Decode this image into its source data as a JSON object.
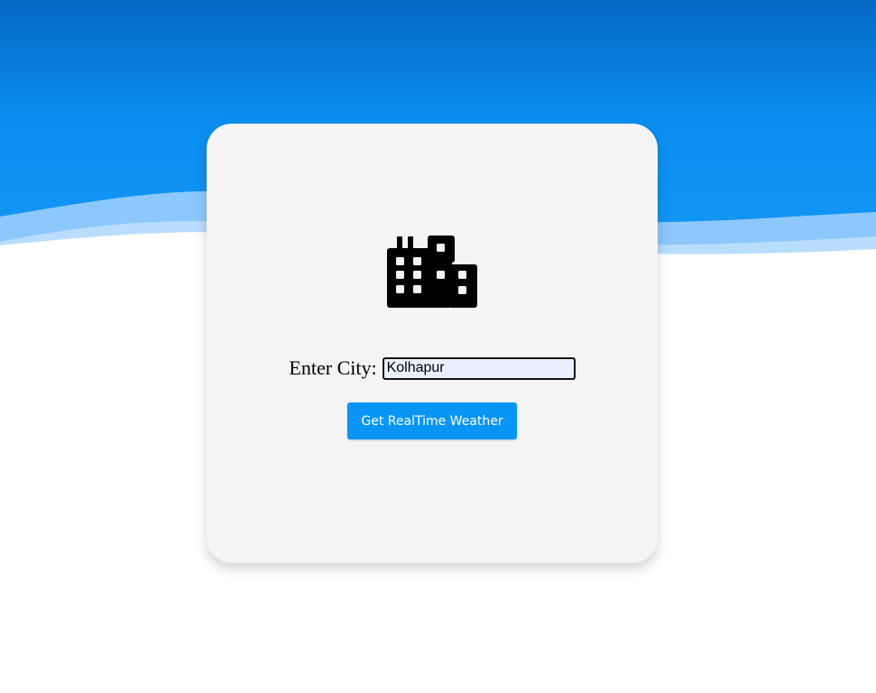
{
  "colors": {
    "sky_top": "#0a6fcc",
    "sky_mid": "#0a8ef0",
    "wave_light": "#8cc8fb",
    "card_bg": "#f4f4f4",
    "button_bg": "#0895f6",
    "input_bg": "#e8f0fe"
  },
  "icons": {
    "hero": "building-icon"
  },
  "form": {
    "city_label": "Enter City:",
    "city_value": "Kolhapur",
    "submit_label": "Get RealTime Weather"
  }
}
